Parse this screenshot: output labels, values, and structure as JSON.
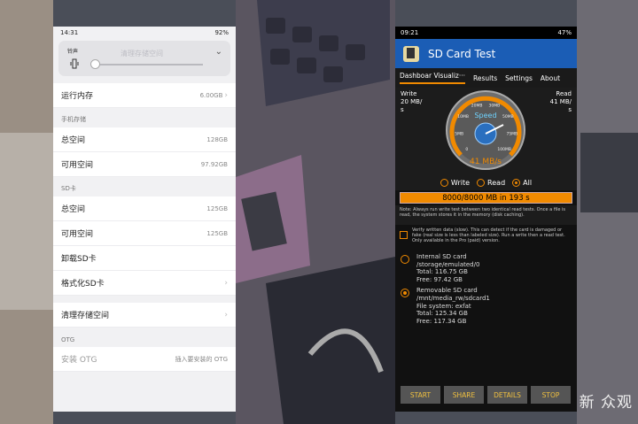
{
  "left_phone": {
    "status": {
      "time": "14:31",
      "right": "92%"
    },
    "volume": {
      "label": "铃声",
      "tip": "清理存储空间"
    },
    "run_memory": {
      "label": "运行内存",
      "value": "6.00GB"
    },
    "phone_storage": {
      "section": "手机存储",
      "total_label": "总空间",
      "total_value": "128GB",
      "avail_label": "可用空间",
      "avail_value": "97.92GB"
    },
    "sd_card": {
      "section": "SD卡",
      "total_label": "总空间",
      "total_value": "125GB",
      "avail_label": "可用空间",
      "avail_value": "125GB",
      "unmount": "卸载SD卡",
      "format": "格式化SD卡"
    },
    "clean": "清理存储空间",
    "otg": {
      "section": "OTG",
      "install_label": "安装 OTG",
      "install_value": "插入要安装的 OTG"
    }
  },
  "right_phone": {
    "status": {
      "time": "09:21",
      "right": "47%"
    },
    "app_title": "SD Card Test",
    "tabs": [
      "Dashboar Visualiz···",
      "Results",
      "Settings",
      "About"
    ],
    "write": {
      "label": "Write",
      "value": "20 MB/",
      "unit": "s"
    },
    "read": {
      "label": "Read",
      "value": "41 MB/",
      "unit": "s"
    },
    "gauge": {
      "label": "Speed",
      "value": "41 MB/s",
      "ticks": [
        "0",
        "5MB",
        "10MB",
        "20MB",
        "30MB",
        "50MB",
        "75MB",
        "100MB"
      ]
    },
    "mode": {
      "write": "Write",
      "read": "Read",
      "all": "All"
    },
    "progress": "8000/8000 MB in 193 s",
    "note": "Note: Always run write test between two identical read tests. Once a file is read, the system stores it in the memory (disk caching).",
    "verify": "Verify written data (slow). This can detect if the card is damaged or fake (real size is less than labeled size). Run a write then a read test. Only available in the Pro (paid) version.",
    "internal": {
      "title": "Internal SD card",
      "path": "/storage/emulated/0",
      "total": "Total: 116.75 GB",
      "free": "Free: 97.42 GB"
    },
    "removable": {
      "title": "Removable SD card",
      "path": "/mnt/media_rw/sdcard1",
      "fs": "File system: exfat",
      "total": "Total: 125.34 GB",
      "free": "Free: 117.34 GB"
    },
    "buttons": {
      "start": "START",
      "share": "SHARE",
      "details": "DETAILS",
      "stop": "STOP"
    }
  },
  "watermark": "新 众观",
  "colors": {
    "accent": "#f18a00",
    "app_bar": "#1b5db5"
  }
}
